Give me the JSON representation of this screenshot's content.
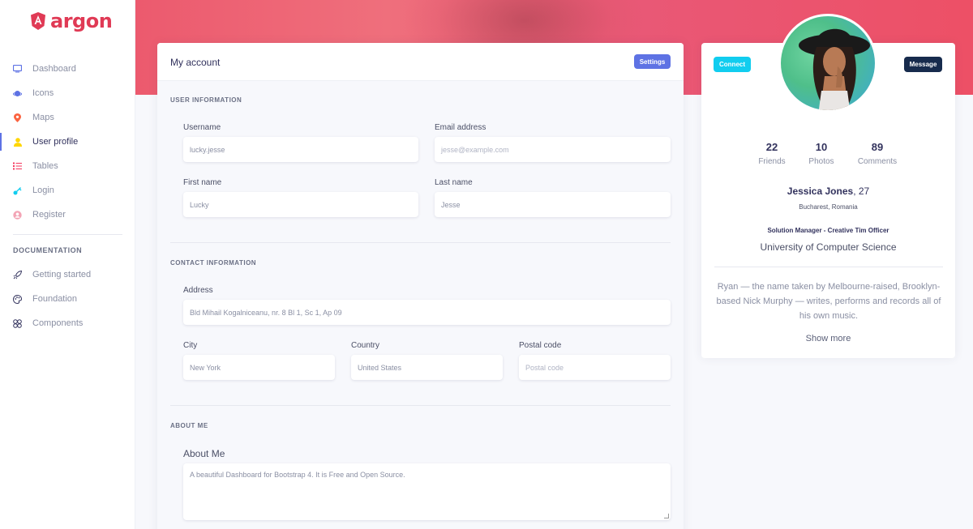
{
  "brand": {
    "name": "argon",
    "color": "#e03a55"
  },
  "sidebar": {
    "items": [
      {
        "label": "Dashboard",
        "icon": "tv-icon",
        "color": "#5e72e4",
        "active": false
      },
      {
        "label": "Icons",
        "icon": "planet-icon",
        "color": "#5e72e4",
        "active": false
      },
      {
        "label": "Maps",
        "icon": "pin-icon",
        "color": "#fb6340",
        "active": false
      },
      {
        "label": "User profile",
        "icon": "single-user-icon",
        "color": "#ffd600",
        "active": true
      },
      {
        "label": "Tables",
        "icon": "bullet-list-icon",
        "color": "#f5365c",
        "active": false
      },
      {
        "label": "Login",
        "icon": "key-icon",
        "color": "#11cdef",
        "active": false
      },
      {
        "label": "Register",
        "icon": "circle-user-icon",
        "color": "#f3a4b5",
        "active": false
      }
    ],
    "docs_heading": "DOCUMENTATION",
    "docs": [
      {
        "label": "Getting started",
        "icon": "spaceship-icon"
      },
      {
        "label": "Foundation",
        "icon": "palette-icon"
      },
      {
        "label": "Components",
        "icon": "ui-04-icon"
      }
    ]
  },
  "account": {
    "title": "My account",
    "settings_label": "Settings",
    "user_info_heading": "USER INFORMATION",
    "username_label": "Username",
    "username_value": "lucky.jesse",
    "email_label": "Email address",
    "email_placeholder": "jesse@example.com",
    "first_name_label": "First name",
    "first_name_value": "Lucky",
    "last_name_label": "Last name",
    "last_name_value": "Jesse",
    "contact_heading": "CONTACT INFORMATION",
    "address_label": "Address",
    "address_value": "Bld Mihail Kogalniceanu, nr. 8 Bl 1, Sc 1, Ap 09",
    "city_label": "City",
    "city_value": "New York",
    "country_label": "Country",
    "country_value": "United States",
    "postal_label": "Postal code",
    "postal_placeholder": "Postal code",
    "about_heading": "ABOUT ME",
    "about_label": "About Me",
    "about_value": "A beautiful Dashboard for Bootstrap 4. It is Free and Open Source."
  },
  "profile": {
    "connect_label": "Connect",
    "message_label": "Message",
    "stats": [
      {
        "value": "22",
        "label": "Friends"
      },
      {
        "value": "10",
        "label": "Photos"
      },
      {
        "value": "89",
        "label": "Comments"
      }
    ],
    "name": "Jessica Jones",
    "age": ", 27",
    "location": "Bucharest, Romania",
    "job": "Solution Manager - Creative Tim Officer",
    "university": "University of Computer Science",
    "bio": "Ryan — the name taken by Melbourne-raised, Brooklyn-based Nick Murphy — writes, performs and records all of his own music.",
    "show_more": "Show more"
  }
}
